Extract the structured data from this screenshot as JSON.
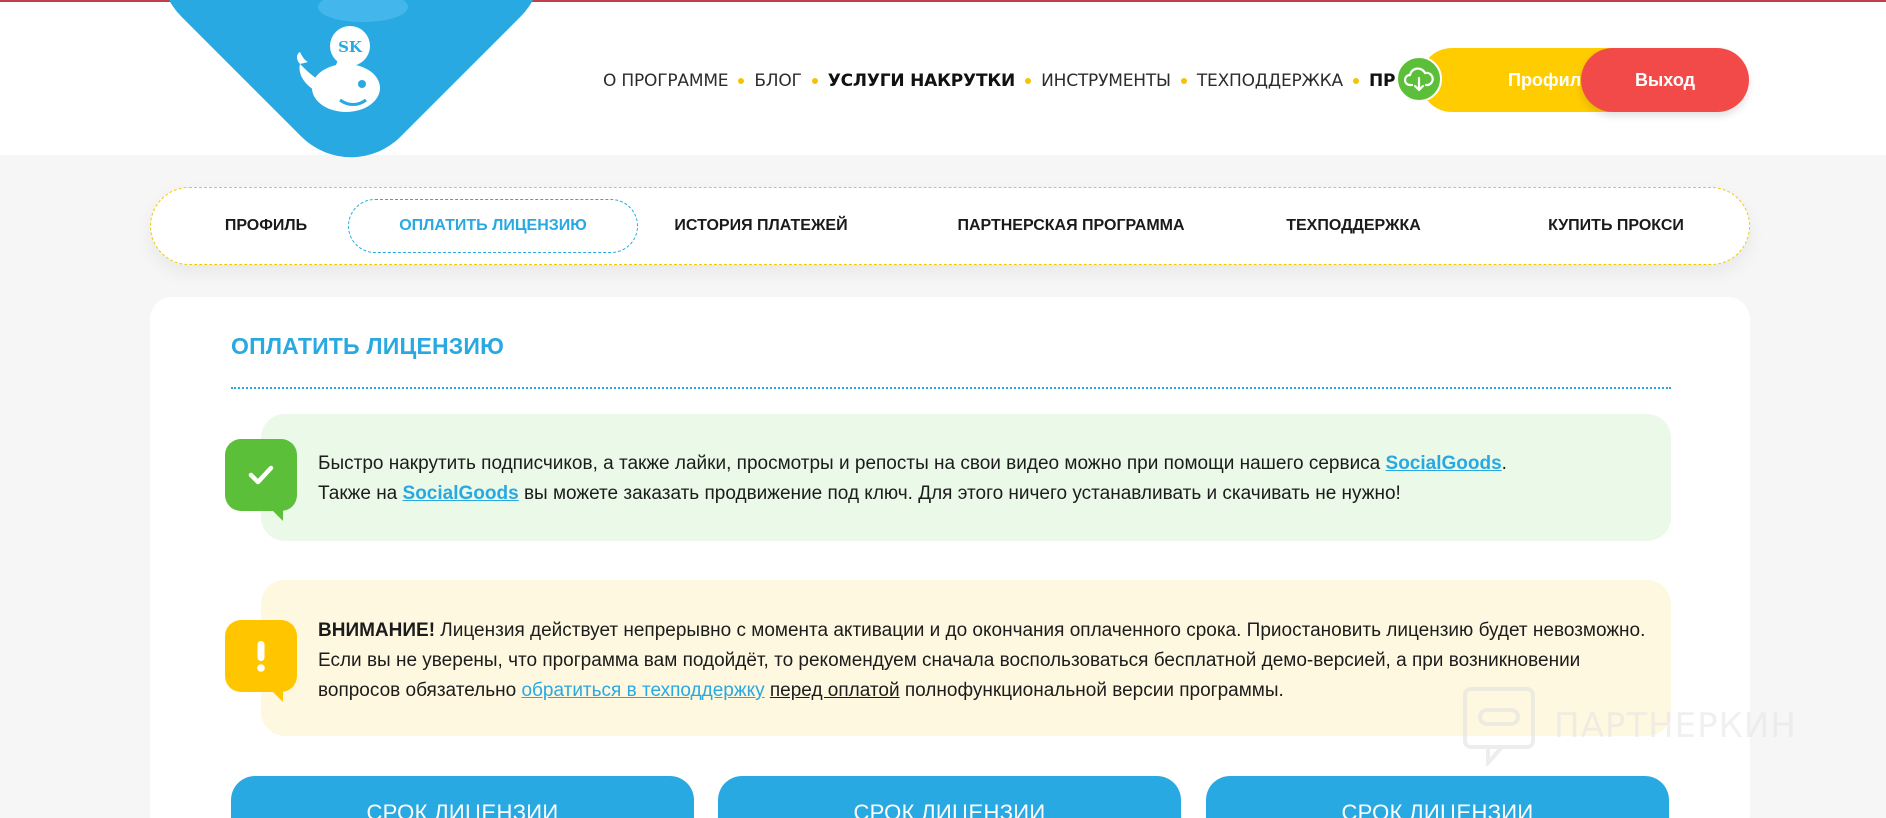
{
  "header": {
    "logo_text": "SK",
    "nav": [
      {
        "label": "О ПРОГРАММЕ",
        "bold": false
      },
      {
        "label": "БЛОГ",
        "bold": false
      },
      {
        "label": "УСЛУГИ НАКРУТКИ",
        "bold": true
      },
      {
        "label": "ИНСТРУМЕНТЫ",
        "bold": false
      },
      {
        "label": "ТЕХПОДДЕРЖКА",
        "bold": false
      },
      {
        "label": "ПРОКСИ",
        "bold": true
      }
    ],
    "download_icon": "cloud-download-icon",
    "profile_label": "Профиль",
    "logout_label": "Выход"
  },
  "tabs": [
    {
      "label": "ПРОФИЛЬ",
      "active": false
    },
    {
      "label": "ОПЛАТИТЬ ЛИЦЕНЗИЮ",
      "active": true
    },
    {
      "label": "ИСТОРИЯ ПЛАТЕЖЕЙ",
      "active": false
    },
    {
      "label": "ПАРТНЕРСКАЯ ПРОГРАММА",
      "active": false
    },
    {
      "label": "ТЕХПОДДЕРЖКА",
      "active": false
    },
    {
      "label": "КУПИТЬ ПРОКСИ",
      "active": false
    }
  ],
  "main": {
    "title": "ОПЛАТИТЬ ЛИЦЕНЗИЮ",
    "notice_success": {
      "icon": "checkmark-icon",
      "line1_before": "Быстро накрутить подписчиков, а также лайки, просмотры и репосты на свои видео можно при помощи нашего сервиса ",
      "line1_link": "SocialGoods",
      "line1_after": ".",
      "line2_before": "Также на ",
      "line2_link": "SocialGoods",
      "line2_after": " вы можете заказать продвижение под ключ. Для этого ничего устанавливать и скачивать не нужно!"
    },
    "notice_warning": {
      "icon": "exclamation-icon",
      "label": "ВНИМАНИЕ!",
      "text_before": " Лицензия действует непрерывно с момента активации и до окончания оплаченного срока. Приостановить лицензию будет невозможно. Если вы не уверены, что программа вам подойдёт, то рекомендуем сначала воспользоваться бесплатной демо-версией, а при возникновении вопросов обязательно ",
      "support_link": "обратиться в техподдержку",
      "space": " ",
      "before_payment": "перед оплатой",
      "text_after": " полнофункциональной версии программы."
    },
    "plans": [
      {
        "label": "СРОК ЛИЦЕНЗИИ"
      },
      {
        "label": "СРОК ЛИЦЕНЗИИ"
      },
      {
        "label": "СРОК ЛИЦЕНЗИИ"
      }
    ]
  },
  "watermark": {
    "text": "ПАРТНЕРКИН",
    "icon": "partnerkin-logo-icon"
  },
  "colors": {
    "accent_blue": "#29a9e1",
    "yellow": "#ffcc00",
    "red": "#f24a48",
    "green": "#5bbf3a"
  }
}
